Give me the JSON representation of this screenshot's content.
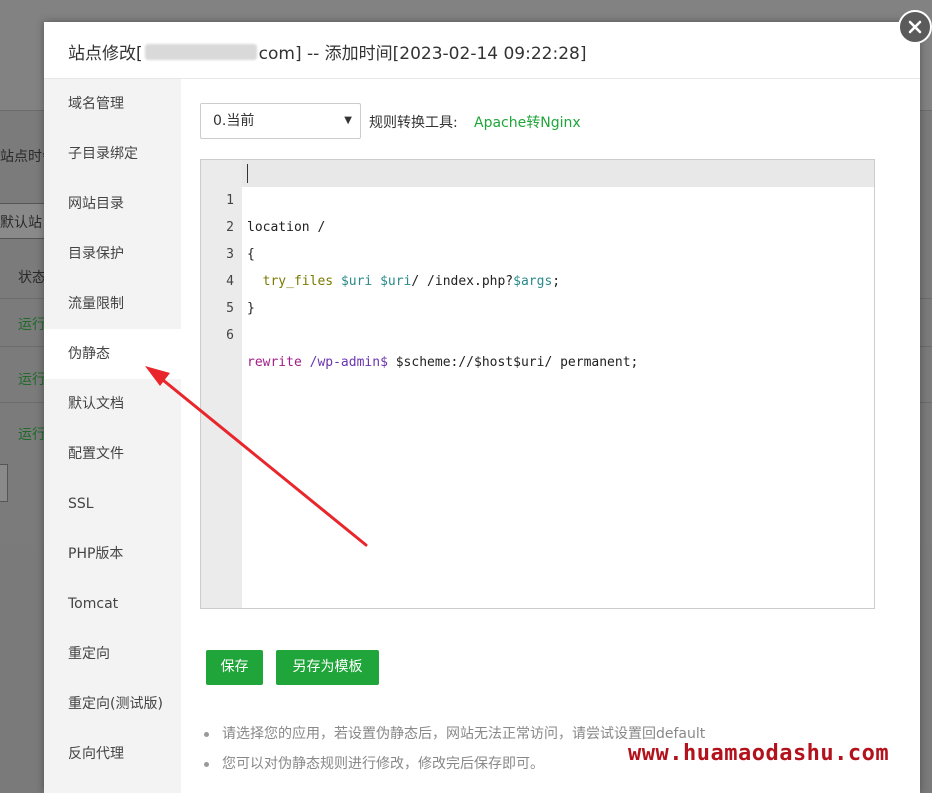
{
  "background": {
    "fragments": [
      "站点时会",
      "默认站",
      "状态"
    ],
    "status_items": [
      "运行",
      "运行",
      "运行"
    ]
  },
  "modal": {
    "title_prefix": "站点修改[",
    "title_suffix": "com] -- 添加时间[2023-02-14 09:22:28]",
    "close_icon": "close-icon"
  },
  "sidebar": {
    "items": [
      {
        "label": "域名管理"
      },
      {
        "label": "子目录绑定"
      },
      {
        "label": "网站目录"
      },
      {
        "label": "目录保护"
      },
      {
        "label": "流量限制"
      },
      {
        "label": "伪静态",
        "active": true
      },
      {
        "label": "默认文档"
      },
      {
        "label": "配置文件"
      },
      {
        "label": "SSL"
      },
      {
        "label": "PHP版本"
      },
      {
        "label": "Tomcat"
      },
      {
        "label": "重定向"
      },
      {
        "label": "重定向(测试版)"
      },
      {
        "label": "反向代理"
      }
    ]
  },
  "rewrite": {
    "select_value": "0.当前",
    "tool_label": "规则转换工具:",
    "tool_link": "Apache转Nginx",
    "editor_lines": [
      {
        "num": "1",
        "text": "location /"
      },
      {
        "num": "2",
        "text": "{"
      },
      {
        "num": "3",
        "text": "  try_files $uri $uri/ /index.php?$args;"
      },
      {
        "num": "4",
        "text": "}"
      },
      {
        "num": "5",
        "text": ""
      },
      {
        "num": "6",
        "text": "rewrite /wp-admin$ $scheme://$host$uri/ permanent;"
      }
    ],
    "save_label": "保存",
    "save_template_label": "另存为模板",
    "tips": [
      "请选择您的应用，若设置伪静态后，网站无法正常访问，请尝试设置回default",
      "您可以对伪静态规则进行修改，修改完后保存即可。"
    ]
  },
  "watermark": "www.huamaodashu.com",
  "colors": {
    "accent": "#20a53a",
    "annotation_arrow": "#e8262b",
    "watermark": "#b3111b"
  }
}
